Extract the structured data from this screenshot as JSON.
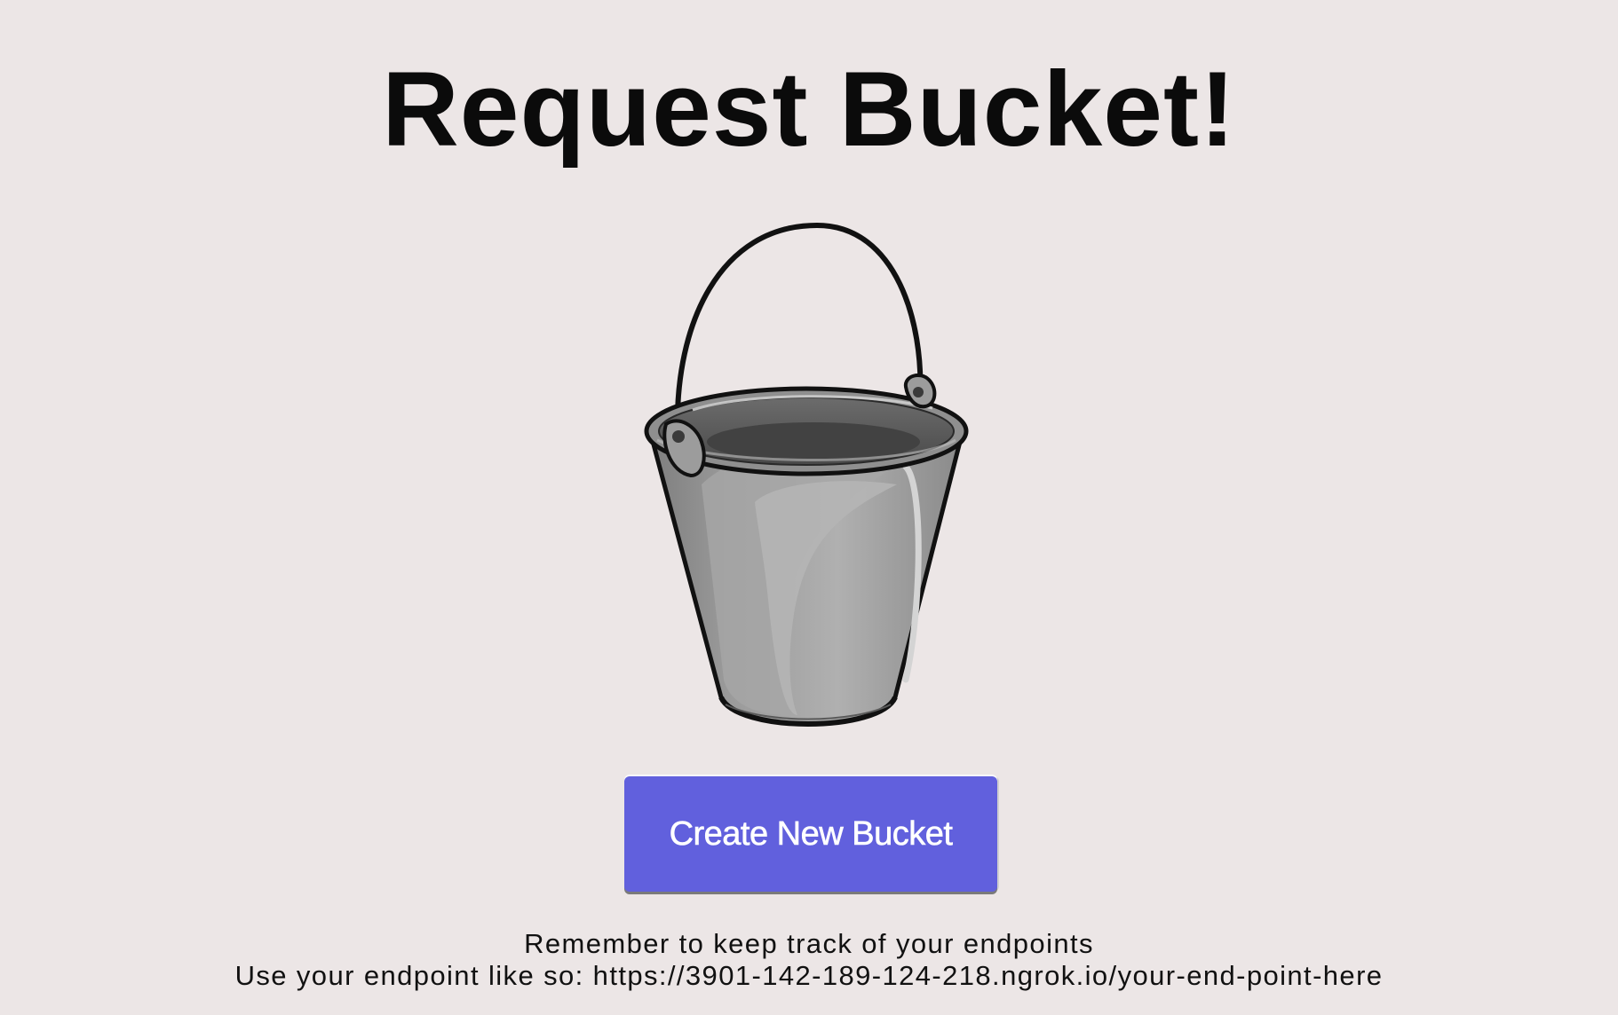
{
  "page": {
    "title": "Request Bucket!",
    "background_color": "#ece6e6"
  },
  "illustration": {
    "icon": "bucket-icon"
  },
  "actions": {
    "create_label": "Create New Bucket",
    "accent_color": "#6160dd"
  },
  "hints": {
    "line1": "Remember to keep track of your endpoints",
    "line2": "Use your endpoint like so: https://3901-142-189-124-218.ngrok.io/your-end-point-here"
  }
}
